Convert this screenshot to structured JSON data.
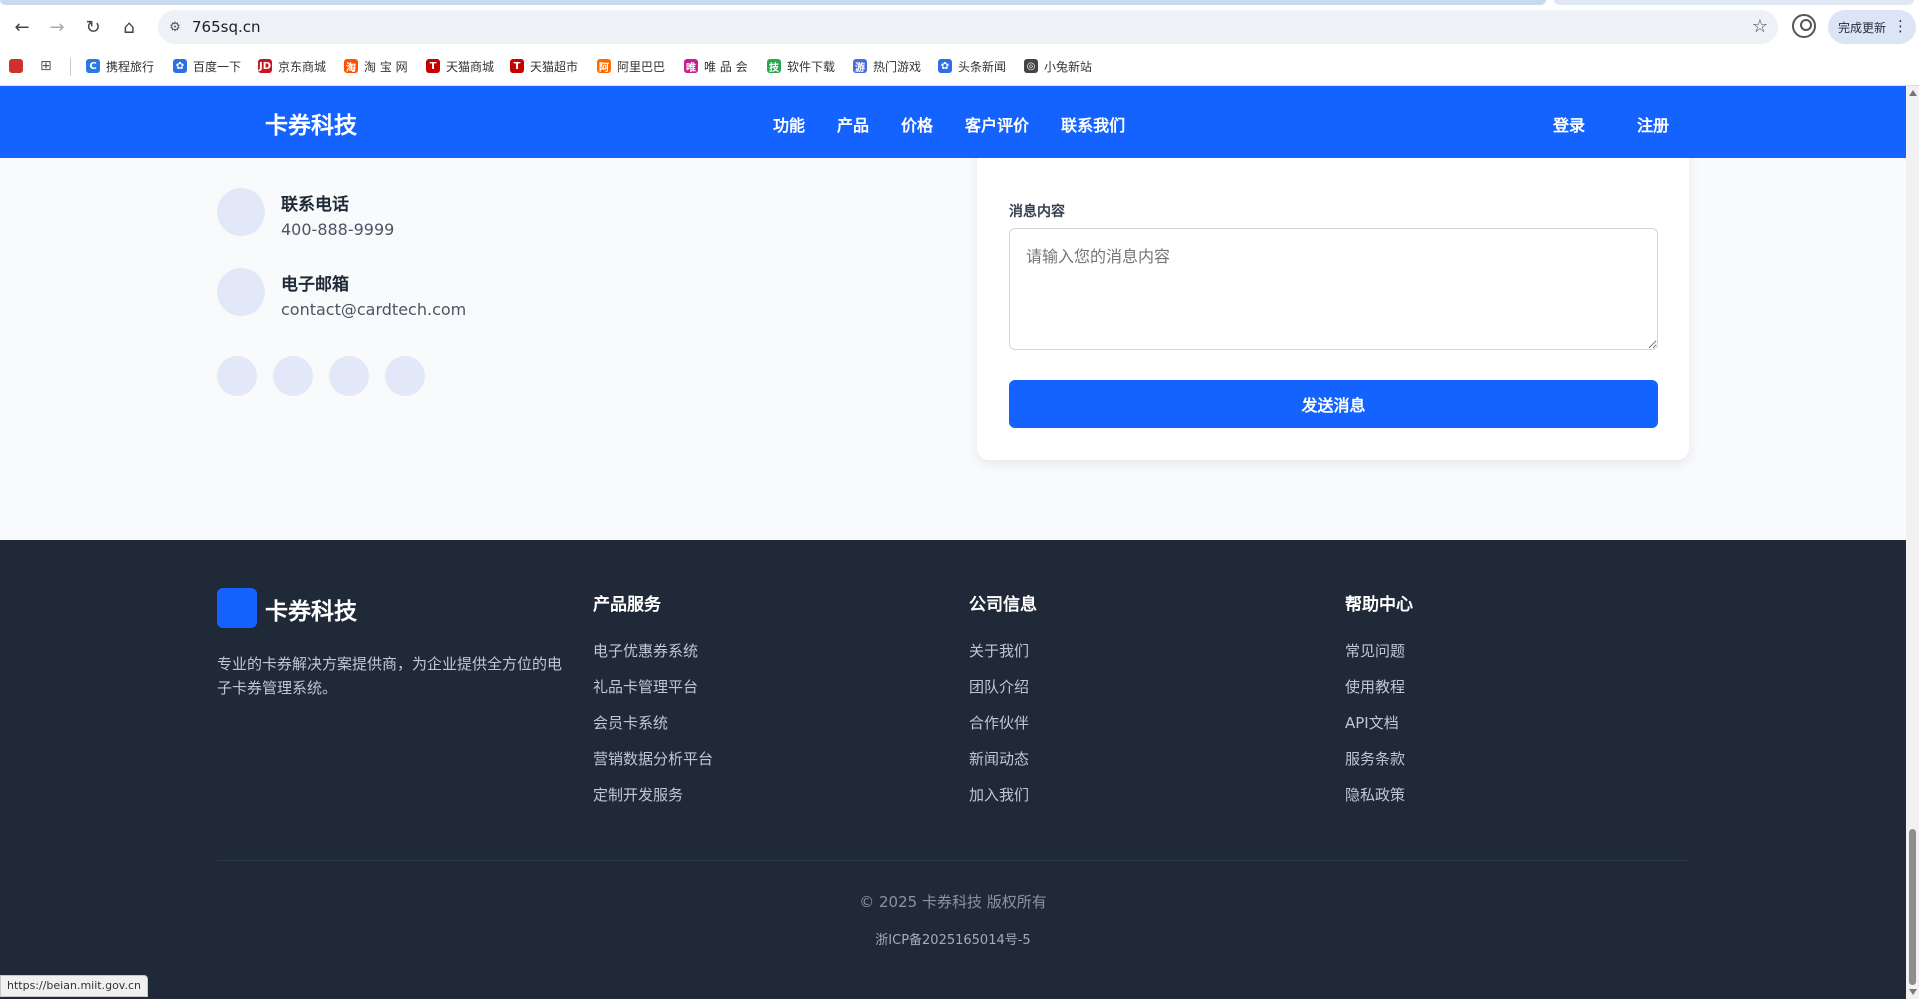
{
  "browser": {
    "url": "765sq.cn",
    "update_label": "完成更新",
    "bookmarks": [
      {
        "label": "携程旅行",
        "icon": "ctrip-icon",
        "color": "#2a7ae2"
      },
      {
        "label": "百度一下",
        "icon": "baidu-paw-icon",
        "color": "#2f6fe4"
      },
      {
        "label": "京东商城",
        "icon": "jd-icon",
        "color": "#c81623"
      },
      {
        "label": "淘 宝 网",
        "icon": "taobao-icon",
        "color": "#ff5000"
      },
      {
        "label": "天猫商城",
        "icon": "tmall-icon",
        "color": "#c40000"
      },
      {
        "label": "天猫超市",
        "icon": "tmall-supermarket-icon",
        "color": "#c40000"
      },
      {
        "label": "阿里巴巴",
        "icon": "alibaba-icon",
        "color": "#ff6a00"
      },
      {
        "label": "唯 品 会",
        "icon": "vip-icon",
        "color": "#c6208e"
      },
      {
        "label": "软件下载",
        "icon": "software-icon",
        "color": "#2aa64d"
      },
      {
        "label": "热门游戏",
        "icon": "game-icon",
        "color": "#4b6bd6"
      },
      {
        "label": "头条新闻",
        "icon": "news-paw-icon",
        "color": "#2f6fe4"
      },
      {
        "label": "小兔新站",
        "icon": "globe-icon",
        "color": "#444444"
      }
    ],
    "status_url": "https://beian.miit.gov.cn"
  },
  "header": {
    "brand": "卡券科技",
    "nav": [
      "功能",
      "产品",
      "价格",
      "客户评价",
      "联系我们"
    ],
    "login": "登录",
    "register": "注册"
  },
  "contact": {
    "phone_label": "联系电话",
    "phone_value": "400-888-9999",
    "email_label": "电子邮箱",
    "email_value": "contact@cardtech.com"
  },
  "form": {
    "message_label": "消息内容",
    "message_placeholder": "请输入您的消息内容",
    "submit_label": "发送消息"
  },
  "footer": {
    "brand": "卡券科技",
    "description": "专业的卡券解决方案提供商，为企业提供全方位的电子卡券管理系统。",
    "columns": [
      {
        "title": "产品服务",
        "links": [
          "电子优惠券系统",
          "礼品卡管理平台",
          "会员卡系统",
          "营销数据分析平台",
          "定制开发服务"
        ]
      },
      {
        "title": "公司信息",
        "links": [
          "关于我们",
          "团队介绍",
          "合作伙伴",
          "新闻动态",
          "加入我们"
        ]
      },
      {
        "title": "帮助中心",
        "links": [
          "常见问题",
          "使用教程",
          "API文档",
          "服务条款",
          "隐私政策"
        ]
      }
    ],
    "copyright": "© 2025 卡券科技 版权所有",
    "icp": "浙ICP备2025165014号-5"
  },
  "colors": {
    "primary": "#1463ff",
    "footer_bg": "#1f2937",
    "page_bg": "#f8fafc"
  }
}
